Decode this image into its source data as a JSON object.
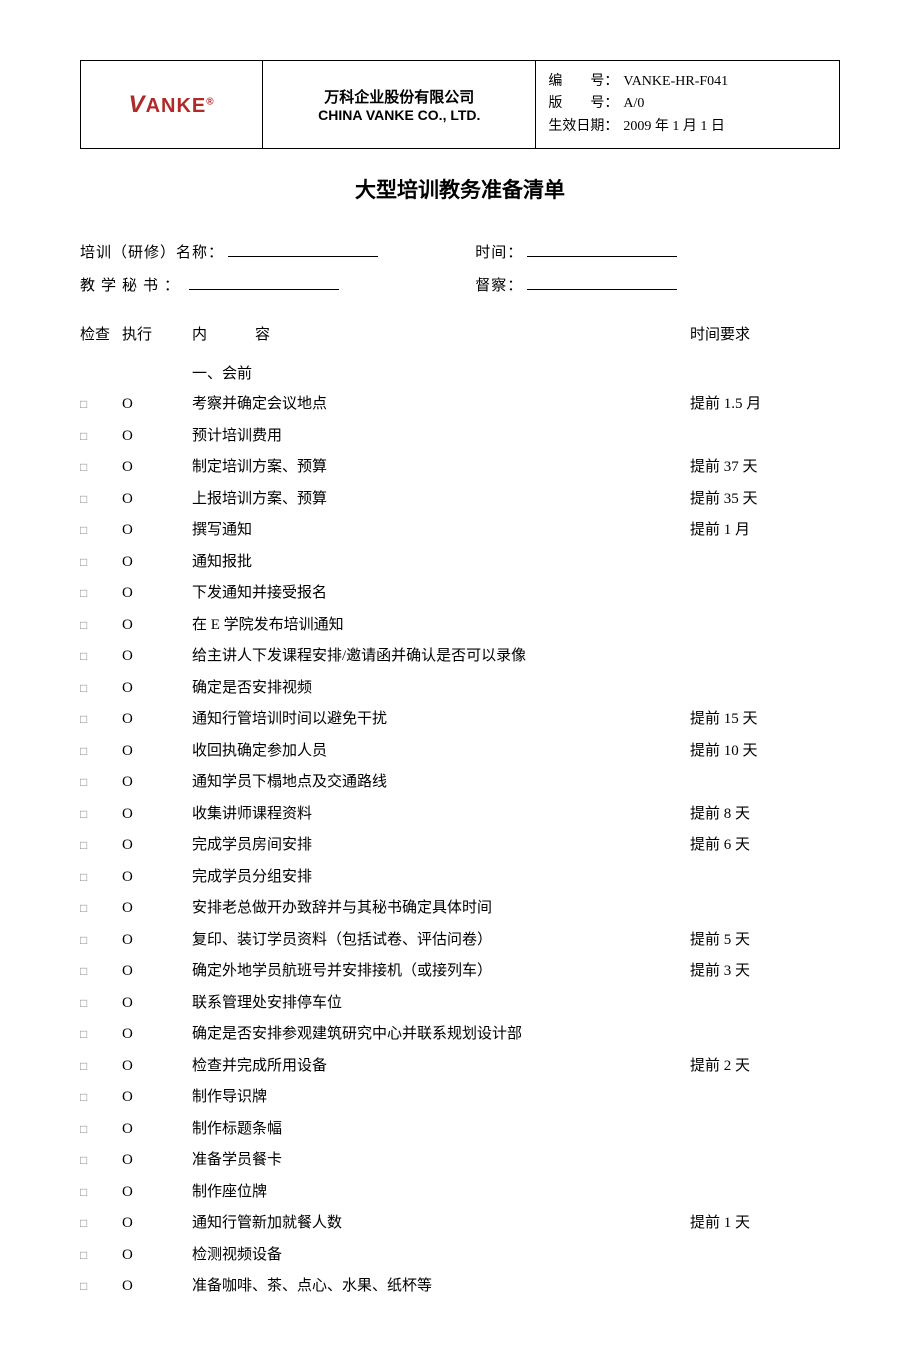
{
  "header": {
    "logo_text": "VANKE",
    "company_cn": "万科企业股份有限公司",
    "company_en": "CHINA VANKE CO., LTD.",
    "doc_no_label": "编　　号：",
    "doc_no": "VANKE-HR-F041",
    "version_label": "版　　号：",
    "version": "A/0",
    "effective_label": "生效日期：",
    "effective": "2009 年 1 月 1 日"
  },
  "title": "大型培训教务准备清单",
  "form": {
    "training_name_label": "培训（研修）名称：",
    "time_label": "时间：",
    "secretary_label": "教学秘书：",
    "supervise_label": "督察："
  },
  "columns": {
    "check": "检查",
    "exec": "执行",
    "content": "内容",
    "time_req": "时间要求"
  },
  "section1_title": "一、会前",
  "rows": [
    {
      "c": "考察并确定会议地点",
      "t": "提前 1.5 月"
    },
    {
      "c": "预计培训费用",
      "t": ""
    },
    {
      "c": "制定培训方案、预算",
      "t": "提前 37 天"
    },
    {
      "c": "上报培训方案、预算",
      "t": "提前 35 天"
    },
    {
      "c": "撰写通知",
      "t": "提前 1 月"
    },
    {
      "c": "通知报批",
      "t": ""
    },
    {
      "c": "下发通知并接受报名",
      "t": ""
    },
    {
      "c": "在 E 学院发布培训通知",
      "t": ""
    },
    {
      "c": "给主讲人下发课程安排/邀请函并确认是否可以录像",
      "t": ""
    },
    {
      "c": "确定是否安排视频",
      "t": ""
    },
    {
      "c": "通知行管培训时间以避免干扰",
      "t": "提前 15 天"
    },
    {
      "c": "收回执确定参加人员",
      "t": "提前 10 天"
    },
    {
      "c": "通知学员下榻地点及交通路线",
      "t": ""
    },
    {
      "c": "收集讲师课程资料",
      "t": "提前 8 天"
    },
    {
      "c": "完成学员房间安排",
      "t": "提前 6 天"
    },
    {
      "c": "完成学员分组安排",
      "t": ""
    },
    {
      "c": "安排老总做开办致辞并与其秘书确定具体时间",
      "t": ""
    },
    {
      "c": "复印、装订学员资料（包括试卷、评估问卷）",
      "t": "提前 5 天"
    },
    {
      "c": "确定外地学员航班号并安排接机（或接列车）",
      "t": "提前 3 天"
    },
    {
      "c": "联系管理处安排停车位",
      "t": ""
    },
    {
      "c": "确定是否安排参观建筑研究中心并联系规划设计部",
      "t": ""
    },
    {
      "c": "检查并完成所用设备",
      "t": "提前 2 天"
    },
    {
      "c": "制作导识牌",
      "t": ""
    },
    {
      "c": "制作标题条幅",
      "t": ""
    },
    {
      "c": "准备学员餐卡",
      "t": ""
    },
    {
      "c": "制作座位牌",
      "t": ""
    },
    {
      "c": "通知行管新加就餐人数",
      "t": "提前 1 天"
    },
    {
      "c": "检测视频设备",
      "t": ""
    },
    {
      "c": "准备咖啡、茶、点心、水果、纸杯等",
      "t": ""
    }
  ],
  "checkbox_glyph": "□",
  "exec_glyph": "O"
}
